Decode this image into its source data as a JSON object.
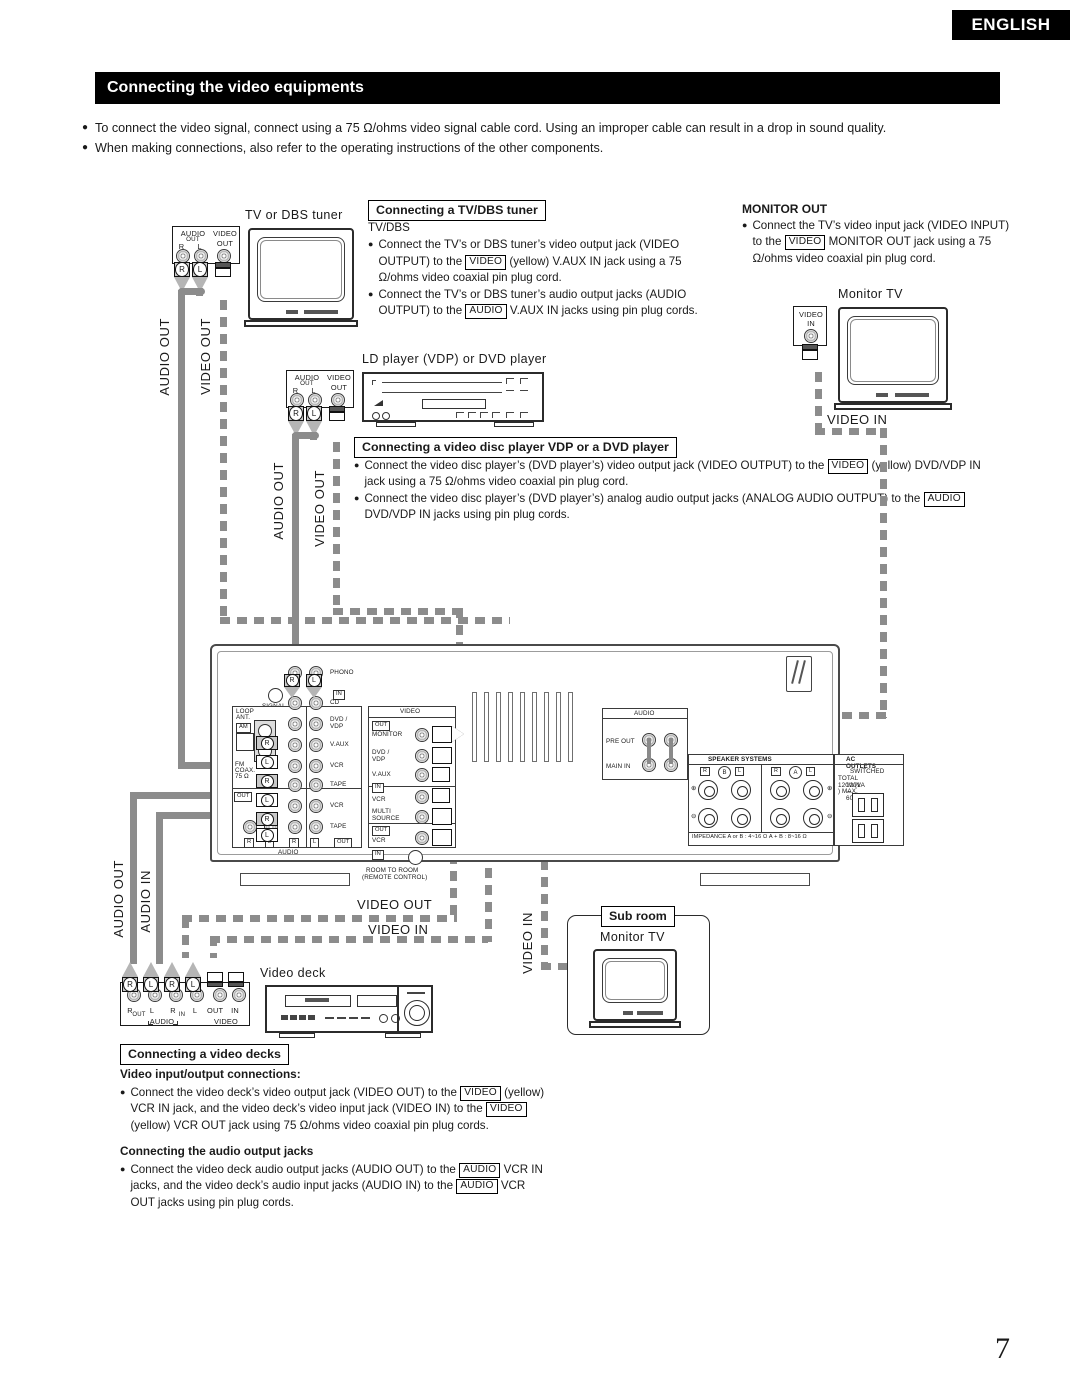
{
  "header": {
    "language_badge": "ENGLISH",
    "section_title": "Connecting the video equipments"
  },
  "intro_bullets": [
    "To connect the video signal, connect using a 75 Ω/ohms video signal cable cord. Using an improper cable can result in a drop in sound quality.",
    "When making connections, also refer to the operating instructions of the other components."
  ],
  "tv_dbs": {
    "device_label": "TV or DBS tuner",
    "caption": "Connecting a TV/DBS tuner",
    "subtitle": "TV/DBS",
    "bullet1": {
      "part1": "Connect the TV’s or DBS tuner’s video output jack (VIDEO OUTPUT) to the",
      "key": "VIDEO",
      "part2": "(yellow) V.AUX IN jack using a 75 Ω/ohms video coaxial pin plug cord."
    },
    "bullet2": {
      "part1": "Connect the TV’s or DBS tuner’s audio output jacks (AUDIO OUTPUT) to the",
      "key": "AUDIO",
      "part2": "V.AUX IN jacks using pin plug cords."
    },
    "jackpanel": {
      "audio": "AUDIO",
      "out": "OUT",
      "r": "R",
      "l": "L",
      "video": "VIDEO",
      "video_out": "OUT"
    },
    "cable_labels": {
      "audio": "AUDIO OUT",
      "video": "VIDEO OUT"
    }
  },
  "vdp": {
    "device_label": "LD player (VDP) or DVD player",
    "caption": "Connecting a video disc player VDP or a DVD player",
    "bullet1": {
      "part1": "Connect the video disc player’s (DVD player’s) video output jack (VIDEO OUTPUT) to the",
      "key": "VIDEO",
      "part2": "(yellow) DVD/VDP IN jack using a 75 Ω/ohms video coaxial pin plug cord."
    },
    "bullet2": {
      "part1": "Connect the video disc player’s (DVD player’s) analog audio output jacks (ANALOG AUDIO OUTPUT) to the",
      "key": "AUDIO",
      "part2": "DVD/VDP IN jacks using pin plug cords."
    },
    "jackpanel": {
      "audio": "AUDIO",
      "out": "OUT",
      "r": "R",
      "l": "L",
      "video": "VIDEO",
      "video_out": "OUT"
    },
    "cable_labels": {
      "audio": "AUDIO OUT",
      "video": "VIDEO OUT"
    }
  },
  "monitor_out": {
    "heading": "MONITOR OUT",
    "bullet": {
      "part1": "Connect the TV’s video input jack (VIDEO INPUT) to the",
      "key": "VIDEO",
      "part2": "MONITOR OUT jack using a 75 Ω/ohms video coaxial pin plug cord."
    },
    "device_label": "Monitor TV",
    "jackpanel": {
      "video": "VIDEO",
      "in": "IN"
    },
    "cable_label": "VIDEO IN"
  },
  "sub_room": {
    "badge": "Sub room",
    "device_label": "Monitor TV",
    "cable_label": "VIDEO IN"
  },
  "video_deck": {
    "device_label": "Video deck",
    "caption": "Connecting a video decks",
    "sub_head_1": "Video input/output connections:",
    "bullet1": {
      "p1": "Connect the video deck’s video output jack (VIDEO OUT) to the",
      "k1": "VIDEO",
      "p2": "(yellow) VCR IN jack, and the video deck’s video input jack (VIDEO IN) to the",
      "k2": "VIDEO",
      "p3": "(yellow) VCR OUT jack using 75 Ω/ohms video coaxial pin plug cords."
    },
    "sub_head_2": "Connecting the audio output jacks",
    "bullet2": {
      "p1": "Connect the video deck audio output jacks (AUDIO OUT) to the",
      "k1": "AUDIO",
      "p2": "VCR IN jacks, and the video deck’s audio input jacks (AUDIO IN) to the",
      "k2": "AUDIO",
      "p3": "VCR OUT jacks using pin plug cords."
    },
    "jackpanel": {
      "r1": "R",
      "out": "OUT",
      "l1": "L",
      "r2": "R",
      "in": "IN",
      "l2": "L",
      "audio": "AUDIO",
      "v_out": "OUT",
      "v_in": "IN",
      "video": "VIDEO"
    },
    "cable_labels": {
      "audio_out": "AUDIO OUT",
      "audio_in": "AUDIO IN",
      "video_out": "VIDEO OUT",
      "video_in": "VIDEO IN"
    }
  },
  "receiver": {
    "phono": "PHONO",
    "signal_gnd": "SIGNAL ⏚\nGND",
    "signal_gnd_l1": "SIGNAL",
    "signal_gnd_l2": "GND",
    "loop_ant": "LOOP\nANT.",
    "loop_ant_l1": "LOOP",
    "loop_ant_l2": "ANT.",
    "am": "AM",
    "fm_coax": "FM\nCOAX.\n75 Ω",
    "fm_l1": "FM",
    "fm_l2": "COAX.",
    "fm_l3": "75 Ω",
    "in_badge": "IN",
    "out_badge": "OUT",
    "audio_group_label": "AUDIO",
    "video_group_label": "VIDEO",
    "audio_rows": [
      "CD",
      "DVD /\nVDP",
      "V.AUX",
      "VCR",
      "TAPE",
      "VCR",
      "TAPE"
    ],
    "audio_row_cd": "CD",
    "audio_row_dvdvdp_l1": "DVD /",
    "audio_row_dvdvdp_l2": "VDP",
    "audio_row_vaux": "V.AUX",
    "audio_row_vcr": "VCR",
    "audio_row_tape": "TAPE",
    "audio_row_vcr2": "VCR",
    "audio_row_tape2": "TAPE",
    "col_r": "R",
    "col_l": "L",
    "col_out": "OUT",
    "video_rows": {
      "monitor": "MONITOR",
      "dvdvdp_l1": "DVD /",
      "dvdvdp_l2": "VDP",
      "vaux": "V.AUX",
      "vcr_in": "VCR",
      "multi_l1": "MULTI",
      "multi_l2": "SOURCE",
      "vcr_out": "VCR",
      "room_l1": "ROOM TO ROOM",
      "room_l2": "(REMOTE CONTROL)"
    },
    "pre_main": {
      "audio": "AUDIO",
      "pre_out": "PRE OUT",
      "main_in": "MAIN IN"
    },
    "speaker": {
      "title": "SPEAKER SYSTEMS",
      "b_r": "R",
      "b_label": "B",
      "b_l": "L",
      "a_r": "R",
      "a_label": "A",
      "a_l": "L",
      "plus": "⊕",
      "minus": "⊖",
      "impedance": "IMPEDANCE  A or B : 4~16 Ω        A + B : 8~16 Ω"
    },
    "ac": {
      "title": "AC  OUTLETS",
      "line1": "SWITCHED",
      "line2": "TOTAL 120W(1A ) MAX.",
      "line3": "120V ∼ 60Hz"
    }
  },
  "page_number": "7"
}
